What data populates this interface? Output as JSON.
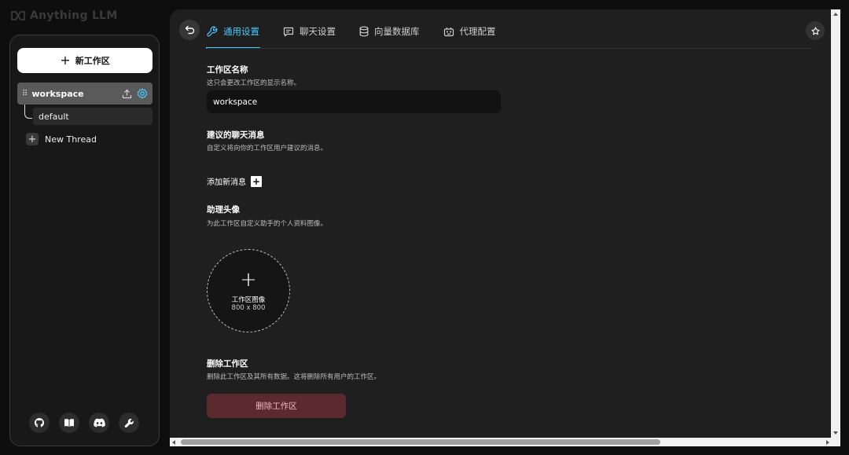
{
  "app": {
    "logo_text": "Anything LLM"
  },
  "sidebar": {
    "new_workspace_label": "新工作区",
    "workspace": {
      "name": "workspace",
      "selected": true
    },
    "threads": [
      {
        "name": "default"
      }
    ],
    "new_thread_label": "New Thread",
    "footer_icons": [
      "github-icon",
      "book-icon",
      "discord-icon",
      "wrench-icon"
    ]
  },
  "main": {
    "tabs": [
      {
        "label": "通用设置",
        "icon": "wrench-icon",
        "active": true
      },
      {
        "label": "聊天设置",
        "icon": "chat-icon",
        "active": false
      },
      {
        "label": "向量数据库",
        "icon": "database-icon",
        "active": false
      },
      {
        "label": "代理配置",
        "icon": "robot-icon",
        "active": false
      }
    ],
    "workspace_name": {
      "title": "工作区名称",
      "description": "这只会更改工作区的显示名称。",
      "value": "workspace"
    },
    "suggested_messages": {
      "title": "建议的聊天消息",
      "description": "自定义将向你的工作区用户建议的消息。",
      "add_label": "添加新消息"
    },
    "assistant_avatar": {
      "title": "助理头像",
      "description": "为此工作区自定义助手的个人资料图像。",
      "upload_label": "工作区图像",
      "upload_size": "800 x 800"
    },
    "delete_workspace": {
      "title": "删除工作区",
      "description": "删除此工作区及其所有数据。这将删除所有用户的工作区。",
      "button_label": "删除工作区"
    }
  },
  "colors": {
    "accent": "#46c8ff",
    "danger_bg": "#5b2a2e",
    "danger_text": "#f2b8bc",
    "panel_bg": "#1f1f1f",
    "sidebar_bg": "#181818"
  }
}
